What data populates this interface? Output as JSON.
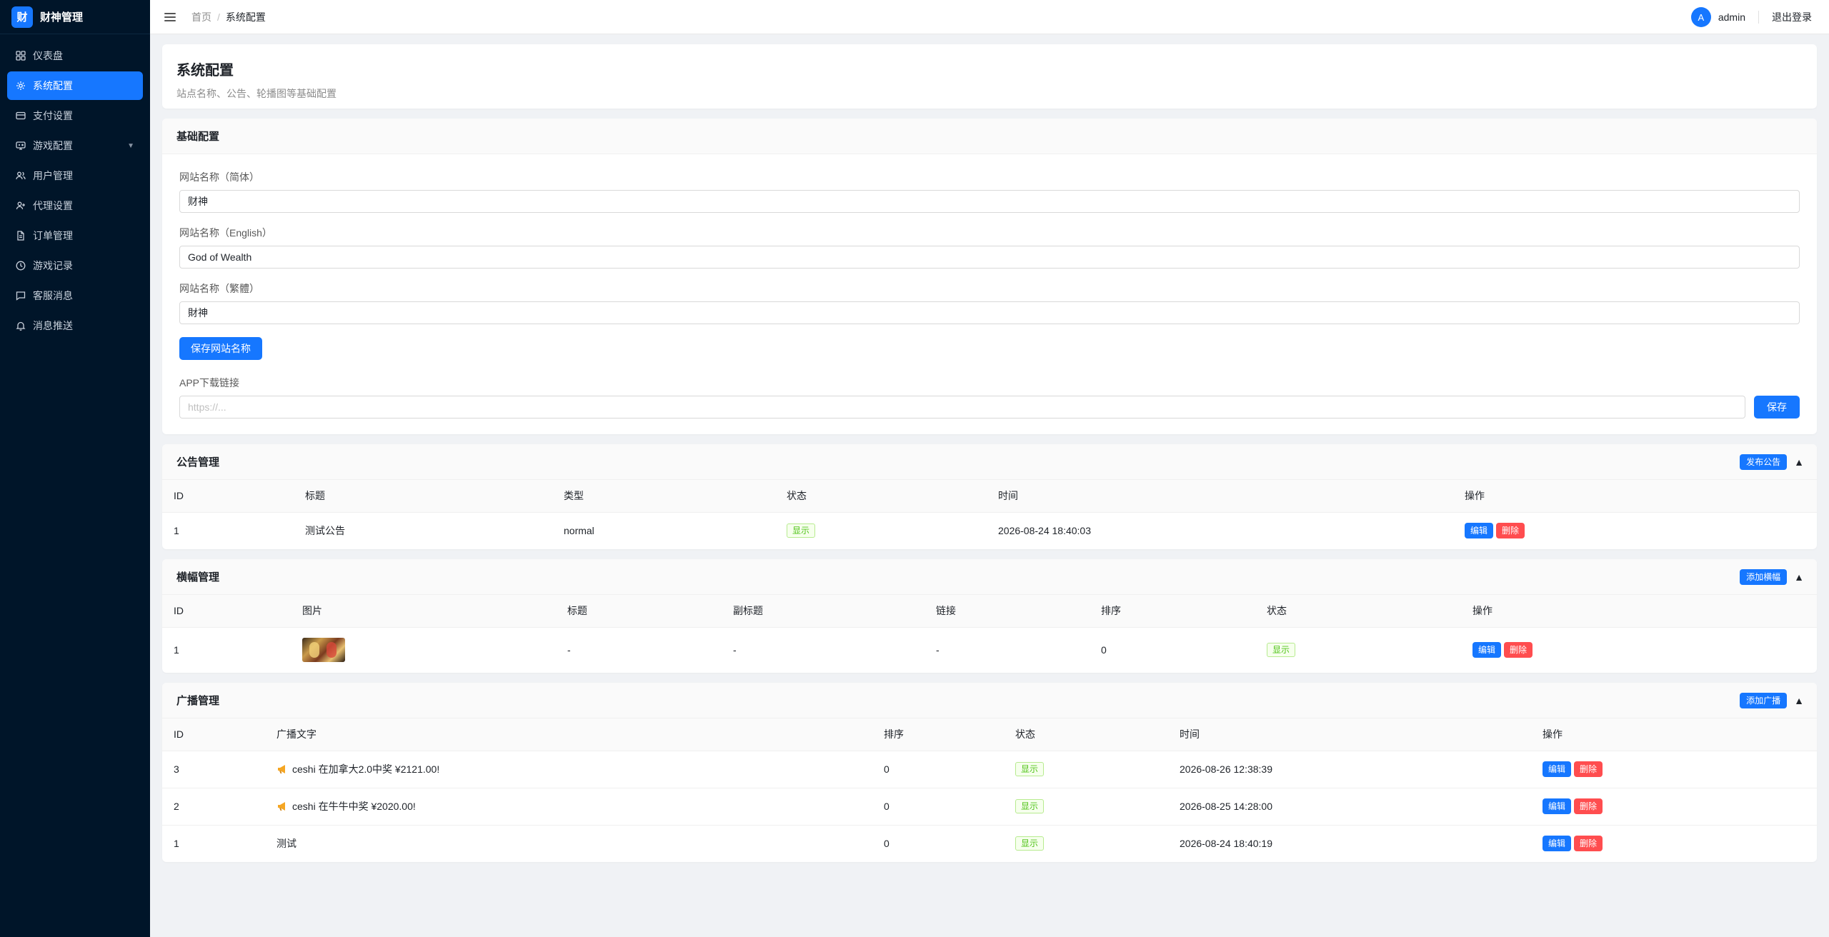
{
  "brand": {
    "logo_char": "财",
    "name": "财神管理"
  },
  "sidebar": {
    "items": [
      {
        "label": "仪表盘",
        "icon": "dashboard-icon"
      },
      {
        "label": "系统配置",
        "icon": "gear-icon",
        "active": true
      },
      {
        "label": "支付设置",
        "icon": "card-icon"
      },
      {
        "label": "游戏配置",
        "icon": "game-icon",
        "caret": "▼"
      },
      {
        "label": "用户管理",
        "icon": "users-icon"
      },
      {
        "label": "代理设置",
        "icon": "user-plus-icon"
      },
      {
        "label": "订单管理",
        "icon": "file-icon"
      },
      {
        "label": "游戏记录",
        "icon": "clock-icon"
      },
      {
        "label": "客服消息",
        "icon": "message-icon"
      },
      {
        "label": "消息推送",
        "icon": "bell-icon"
      }
    ]
  },
  "header": {
    "breadcrumb": {
      "home": "首页",
      "sep": "/",
      "current": "系统配置"
    },
    "avatar_letter": "A",
    "username": "admin",
    "logout": "退出登录"
  },
  "page": {
    "title": "系统配置",
    "subtitle": "站点名称、公告、轮播图等基础配置"
  },
  "basic": {
    "title": "基础配置",
    "name_cn_label": "网站名称（简体）",
    "name_cn_value": "财神",
    "name_en_label": "网站名称（English）",
    "name_en_value": "God of Wealth",
    "name_tw_label": "网站名称（繁體）",
    "name_tw_value": "財神",
    "save_names": "保存网站名称",
    "app_label": "APP下载链接",
    "app_placeholder": "https://...",
    "save": "保存"
  },
  "notice": {
    "title": "公告管理",
    "add": "发布公告",
    "collapse": "▲",
    "columns": [
      "ID",
      "标题",
      "类型",
      "状态",
      "时间",
      "操作"
    ],
    "rows": [
      {
        "id": "1",
        "title": "测试公告",
        "type": "normal",
        "status": "显示",
        "time": "2026-08-24 18:40:03",
        "edit": "编辑",
        "delete": "删除"
      }
    ]
  },
  "banner": {
    "title": "横幅管理",
    "add": "添加横幅",
    "collapse": "▲",
    "columns": [
      "ID",
      "图片",
      "标题",
      "副标题",
      "链接",
      "排序",
      "状态",
      "操作"
    ],
    "rows": [
      {
        "id": "1",
        "title": "-",
        "subtitle": "-",
        "link": "-",
        "sort": "0",
        "status": "显示",
        "edit": "编辑",
        "delete": "删除"
      }
    ]
  },
  "broadcast": {
    "title": "广播管理",
    "add": "添加广播",
    "collapse": "▲",
    "columns": [
      "ID",
      "广播文字",
      "排序",
      "状态",
      "时间",
      "操作"
    ],
    "rows": [
      {
        "id": "3",
        "text": "ceshi 在加拿大2.0中奖 ¥2121.00!",
        "icon": true,
        "sort": "0",
        "status": "显示",
        "time": "2026-08-26 12:38:39",
        "edit": "编辑",
        "delete": "删除"
      },
      {
        "id": "2",
        "text": "ceshi 在牛牛中奖 ¥2020.00!",
        "icon": true,
        "sort": "0",
        "status": "显示",
        "time": "2026-08-25 14:28:00",
        "edit": "编辑",
        "delete": "删除"
      },
      {
        "id": "1",
        "text": "测试",
        "icon": false,
        "sort": "0",
        "status": "显示",
        "time": "2026-08-24 18:40:19",
        "edit": "编辑",
        "delete": "删除"
      }
    ]
  }
}
